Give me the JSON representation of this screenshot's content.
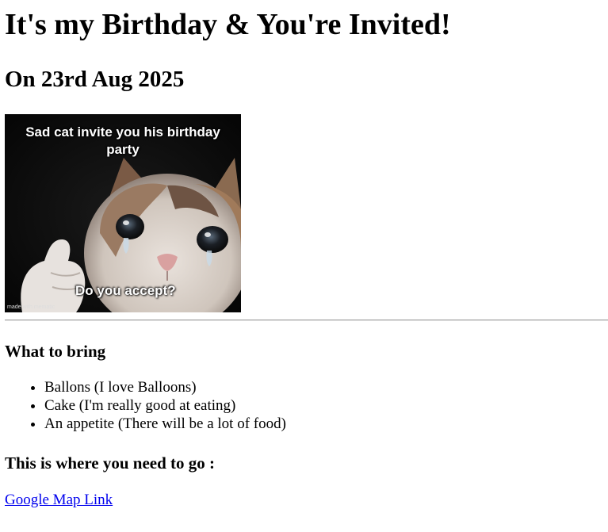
{
  "header": {
    "title": "It's my Birthday & You're Invited!",
    "date_line": "On 23rd Aug 2025"
  },
  "image": {
    "description_icon": "sad-cat-thumbs-up-meme",
    "top_caption": "Sad cat invite you his birthday party",
    "bottom_caption": "Do you accept?",
    "watermark": "made with mematic"
  },
  "bring": {
    "heading": "What to bring",
    "items": [
      "Ballons (I love Balloons)",
      "Cake (I'm really good at eating)",
      "An appetite (There will be a lot of food)"
    ]
  },
  "directions": {
    "heading": "This is where you need to go :",
    "link_text": "Google Map Link"
  },
  "colors": {
    "link": "#0000ee",
    "text": "#000000",
    "background": "#ffffff"
  }
}
